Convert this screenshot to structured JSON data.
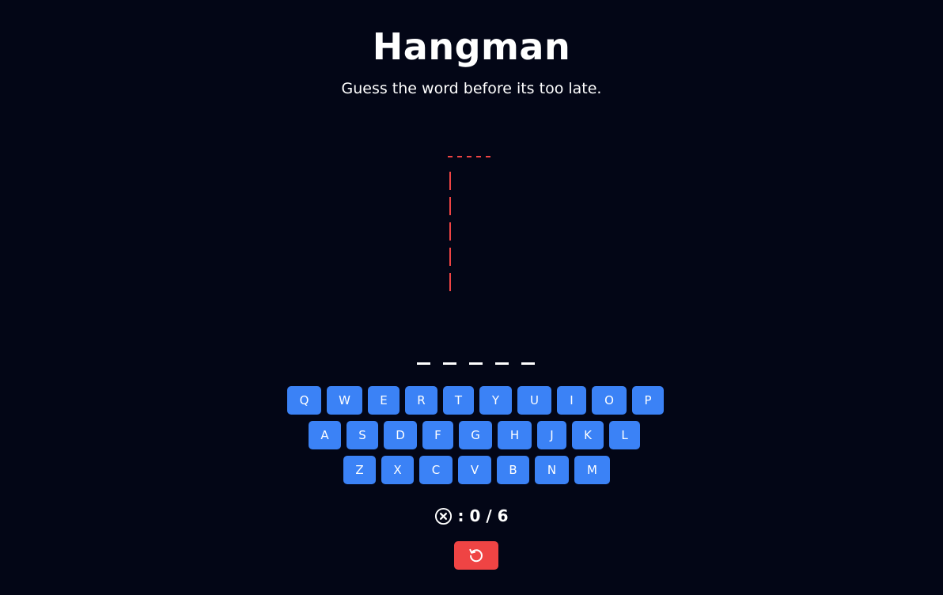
{
  "header": {
    "title": "Hangman",
    "subtitle": "Guess the word before its too late."
  },
  "word": {
    "length": 5,
    "revealed": [
      "",
      "",
      "",
      "",
      ""
    ]
  },
  "keyboard": {
    "rows": [
      [
        "Q",
        "W",
        "E",
        "R",
        "T",
        "Y",
        "U",
        "I",
        "O",
        "P"
      ],
      [
        "A",
        "S",
        "D",
        "F",
        "G",
        "H",
        "J",
        "K",
        "L"
      ],
      [
        "Z",
        "X",
        "C",
        "V",
        "B",
        "N",
        "M"
      ]
    ]
  },
  "status": {
    "icon": "circle-x-icon",
    "text": ": 0 / 6",
    "wrong_guesses": 0,
    "max_guesses": 6
  },
  "controls": {
    "reset_icon": "restart-icon"
  },
  "colors": {
    "background": "#030616",
    "key": "#3b82f6",
    "reset": "#ef4444",
    "gallows": "#ef4444",
    "text": "#ffffff"
  }
}
